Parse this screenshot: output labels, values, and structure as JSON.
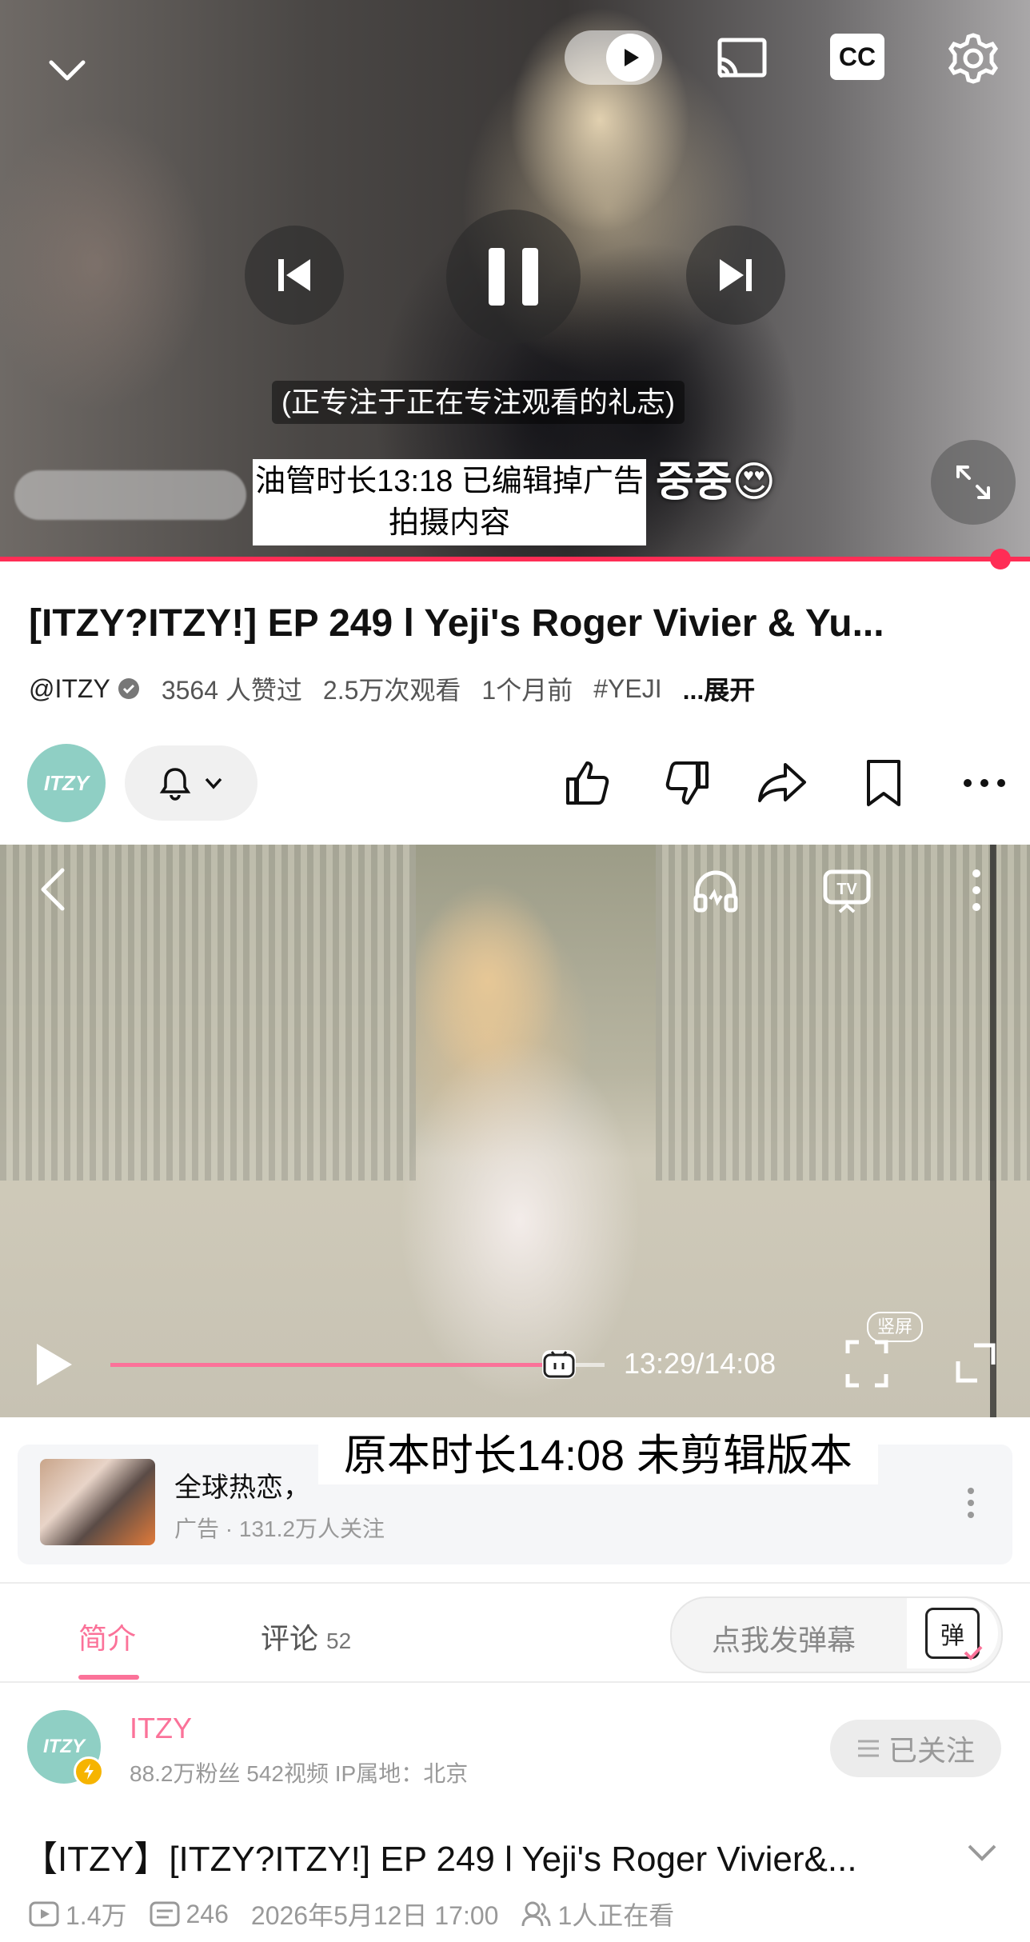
{
  "top_player": {
    "subtitle": "(正专注于正在专注观看的礼志)",
    "korean_subtitle": "중중😍",
    "note": "油管时长13:18 已编辑掉广告拍摄内容"
  },
  "video_info": {
    "title": "[ITZY?ITZY!] EP 249 l Yeji's Roger Vivier & Yu...",
    "channel": "@ITZY",
    "likes": "3564 人赞过",
    "views": "2.5万次观看",
    "time_ago": "1个月前",
    "hashtag": "#YEJI",
    "expand": "...展开"
  },
  "channel_logo": "ITZY",
  "bili_player": {
    "current_time": "13:29/14:08",
    "progress": 0.955,
    "vertical_label": "竖屏",
    "note": "原本时长14:08 未剪辑版本"
  },
  "ad": {
    "title": "全球热恋，",
    "subtitle": "广告 · 131.2万人关注"
  },
  "tabs": {
    "intro": "简介",
    "comments": "评论",
    "comments_count": "52"
  },
  "danmaku": {
    "placeholder": "点我发弹幕",
    "button": "弹"
  },
  "uploader": {
    "name": "ITZY",
    "stats": "88.2万粉丝  542视频  IP属地：北京",
    "follow_label": "已关注"
  },
  "video2": {
    "title": "【ITZY】[ITZY?ITZY!] EP 249 l Yeji's Roger Vivier&...",
    "plays": "1.4万",
    "danmaku_count": "246",
    "date": "2026年5月12日 17:00",
    "watching": "1人正在看"
  },
  "colors": {
    "bili_pink": "#fb7299",
    "yt_red": "#ff2d55"
  }
}
